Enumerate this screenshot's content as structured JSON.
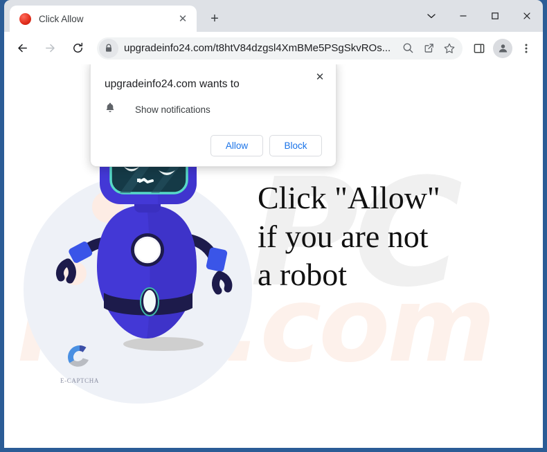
{
  "window": {
    "frame_color": "#2b5c96",
    "controls": [
      {
        "name": "tab-search",
        "icon": "chevron-down-icon"
      },
      {
        "name": "minimize",
        "icon": "minimize-icon"
      },
      {
        "name": "maximize",
        "icon": "maximize-icon"
      },
      {
        "name": "close",
        "icon": "close-icon"
      }
    ]
  },
  "tabstrip": {
    "active_tab": {
      "title": "Click Allow",
      "favicon": "red-circle-favicon",
      "close_glyph": "✕"
    },
    "new_tab_glyph": "+"
  },
  "toolbar": {
    "back_icon": "back-arrow-icon",
    "forward_icon": "forward-arrow-icon",
    "reload_icon": "reload-icon",
    "lock_icon": "lock-icon",
    "url": "upgradeinfo24.com/t8htV84dzgsl4XmBMe5PSgSkvROs...",
    "omnibox_icons": [
      {
        "name": "search-icon"
      },
      {
        "name": "share-icon"
      },
      {
        "name": "bookmark-star-icon"
      }
    ],
    "right_icons": [
      {
        "name": "side-panel-icon"
      },
      {
        "name": "profile-avatar-icon"
      },
      {
        "name": "more-menu-icon"
      }
    ]
  },
  "permission_bubble": {
    "title": "upgradeinfo24.com wants to",
    "permission": "Show notifications",
    "permission_icon": "bell-icon",
    "close_glyph": "✕",
    "allow_label": "Allow",
    "block_label": "Block",
    "accent_color": "#1a73e8"
  },
  "page": {
    "headline_lines": [
      "Click \"Allow\"",
      "if you are not",
      "a robot"
    ],
    "captcha_label": "E-CAPTCHA",
    "captcha_colors": {
      "blue_light": "#4a90e2",
      "blue_dark": "#3b4fa8",
      "gray": "#b9bcc2"
    },
    "robot_colors": {
      "body": "#4338d6",
      "body_shade": "#3a2fc0",
      "dark": "#1d1b4b",
      "screen": "#153a47",
      "screen_border": "#57d8c8",
      "eye": "#f2fbfb"
    },
    "watermarks": [
      {
        "text": "PC",
        "color": "#f0f0f0"
      },
      {
        "text": "risk.com",
        "color": "#fdf1eb"
      }
    ],
    "shadow_color": "#cfcfcf",
    "blob_color": "#eef1f7"
  }
}
